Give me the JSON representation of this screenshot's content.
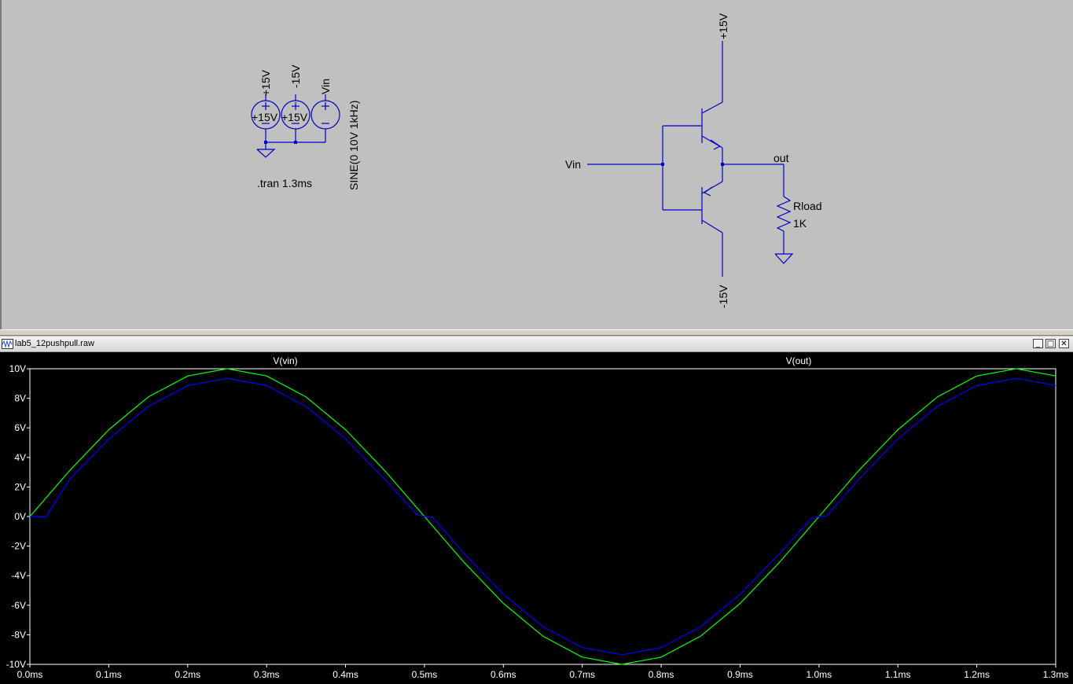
{
  "schematic": {
    "sources": [
      {
        "net": "+15V",
        "value": "+15V"
      },
      {
        "net": "-15V",
        "value": "+15V"
      },
      {
        "net": "Vin",
        "value": ""
      }
    ],
    "sine_spec": "SINE(0 10V 1kHz)",
    "directive": ".tran 1.3ms",
    "amp": {
      "input_label": "Vin",
      "output_label": "out",
      "supply_pos": "+15V",
      "supply_neg": "-15V",
      "load_name": "Rload",
      "load_value": "1K"
    }
  },
  "wave_window": {
    "title": "lab5_12pushpull.raw",
    "controls": {
      "minimize": "_",
      "maximize": "□",
      "close": "✕"
    }
  },
  "chart_data": {
    "type": "line",
    "xlabel": "",
    "ylabel": "",
    "xlim": [
      0,
      1.3
    ],
    "ylim": [
      -10,
      10
    ],
    "x_ticks": [
      "0.0ms",
      "0.1ms",
      "0.2ms",
      "0.3ms",
      "0.4ms",
      "0.5ms",
      "0.6ms",
      "0.7ms",
      "0.8ms",
      "0.9ms",
      "1.0ms",
      "1.1ms",
      "1.2ms",
      "1.3ms"
    ],
    "y_ticks": [
      "10V",
      "8V",
      "6V",
      "4V",
      "2V",
      "0V",
      "-2V",
      "-4V",
      "-6V",
      "-8V",
      "-10V"
    ],
    "grid": false,
    "series": [
      {
        "name": "V(vin)",
        "color": "#00ff00",
        "x": [
          0,
          0.05,
          0.1,
          0.15,
          0.2,
          0.25,
          0.3,
          0.35,
          0.4,
          0.45,
          0.5,
          0.55,
          0.6,
          0.65,
          0.7,
          0.75,
          0.8,
          0.85,
          0.9,
          0.95,
          1.0,
          1.05,
          1.1,
          1.15,
          1.2,
          1.25,
          1.3
        ],
        "y": [
          0,
          3.09,
          5.88,
          8.09,
          9.51,
          10,
          9.51,
          8.09,
          5.88,
          3.09,
          0,
          -3.09,
          -5.88,
          -8.09,
          -9.51,
          -10,
          -9.51,
          -8.09,
          -5.88,
          -3.09,
          0,
          3.09,
          5.88,
          8.09,
          9.51,
          10,
          9.51
        ]
      },
      {
        "name": "V(out)",
        "color": "#0000ff",
        "x": [
          0,
          0.01,
          0.02,
          0.05,
          0.1,
          0.15,
          0.2,
          0.25,
          0.3,
          0.35,
          0.4,
          0.45,
          0.49,
          0.5,
          0.51,
          0.55,
          0.6,
          0.65,
          0.7,
          0.75,
          0.8,
          0.85,
          0.9,
          0.95,
          0.99,
          1.0,
          1.01,
          1.05,
          1.1,
          1.15,
          1.2,
          1.25,
          1.3
        ],
        "y": [
          0,
          0,
          -0.05,
          2.5,
          5.25,
          7.45,
          8.86,
          9.35,
          8.86,
          7.45,
          5.25,
          2.5,
          0.15,
          0,
          -0.05,
          -2.5,
          -5.25,
          -7.45,
          -8.86,
          -9.35,
          -8.86,
          -7.45,
          -5.25,
          -2.5,
          -0.15,
          0,
          0.05,
          2.5,
          5.25,
          7.45,
          8.86,
          9.35,
          8.86
        ]
      }
    ]
  }
}
